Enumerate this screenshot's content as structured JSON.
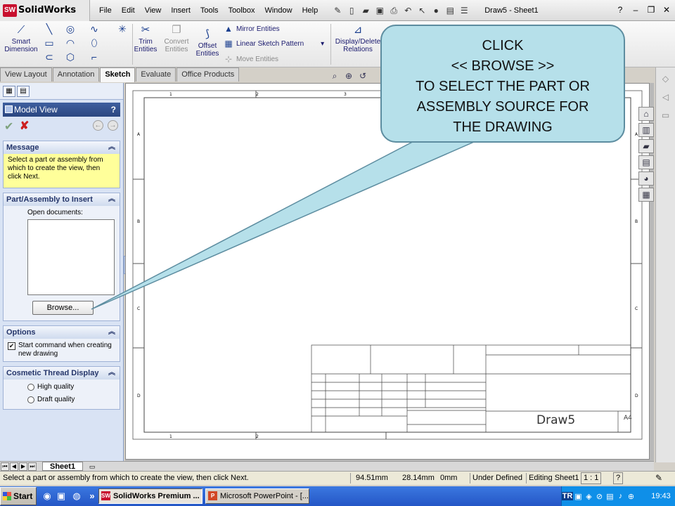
{
  "app": {
    "name": "SolidWorks",
    "logo_badge": "SW",
    "doc_title": "Draw5 - Sheet1"
  },
  "menu": [
    "File",
    "Edit",
    "View",
    "Insert",
    "Tools",
    "Toolbox",
    "Window",
    "Help"
  ],
  "command_manager": {
    "smart_dimension": [
      "Smart",
      "Dimension"
    ],
    "trim": [
      "Trim",
      "Entities"
    ],
    "convert": [
      "Convert",
      "Entities"
    ],
    "offset": [
      "Offset",
      "Entities"
    ],
    "mirror": "Mirror Entities",
    "linear_pattern": "Linear Sketch Pattern",
    "move": "Move Entities",
    "display_delete": [
      "Display/Delete",
      "Relations"
    ]
  },
  "tabs": [
    "View Layout",
    "Annotation",
    "Sketch",
    "Evaluate",
    "Office Products"
  ],
  "active_tab": "Sketch",
  "property_manager": {
    "title": "Model View",
    "help": "?",
    "message_head": "Message",
    "message": "Select a part or assembly from which to create the view, then click Next.",
    "part_head": "Part/Assembly to Insert",
    "open_docs_label": "Open documents:",
    "browse": "Browse...",
    "options_head": "Options",
    "start_command": "Start command when creating new drawing",
    "cosmetic_head": "Cosmetic Thread Display",
    "high_quality": "High quality",
    "draft_quality": "Draft quality"
  },
  "callout": {
    "lines": [
      "CLICK",
      "<< BROWSE >>",
      "TO SELECT THE PART OR",
      "ASSEMBLY SOURCE FOR",
      "THE DRAWING"
    ]
  },
  "drawing": {
    "top_numbers": [
      "1",
      "2",
      "3"
    ],
    "bottom_numbers": [
      "1",
      "2"
    ],
    "left_letters": [
      "A",
      "B",
      "C",
      "D"
    ],
    "title": "Draw5",
    "sheet_size": "A4"
  },
  "sheet_tab": "Sheet1",
  "status": {
    "message": "Select a part or assembly from which to create the view, then click Next.",
    "x": "94.51mm",
    "y": "28.14mm",
    "z": "0mm",
    "definition": "Under Defined",
    "editing": "Editing Sheet1",
    "scale": "1 : 1",
    "help": "?"
  },
  "taskbar": {
    "start": "Start",
    "more": "»",
    "solidworks_task": "SolidWorks Premium ...",
    "powerpoint_task": "Microsoft PowerPoint - [...",
    "lang": "TR",
    "clock": "19:43"
  },
  "colors": {
    "callout_fill": "#b6e0ea",
    "callout_border": "#5d8da0",
    "message_bg": "#ffff9a",
    "panel_bg": "#d9e3f4",
    "taskbar": "#2456c6"
  }
}
